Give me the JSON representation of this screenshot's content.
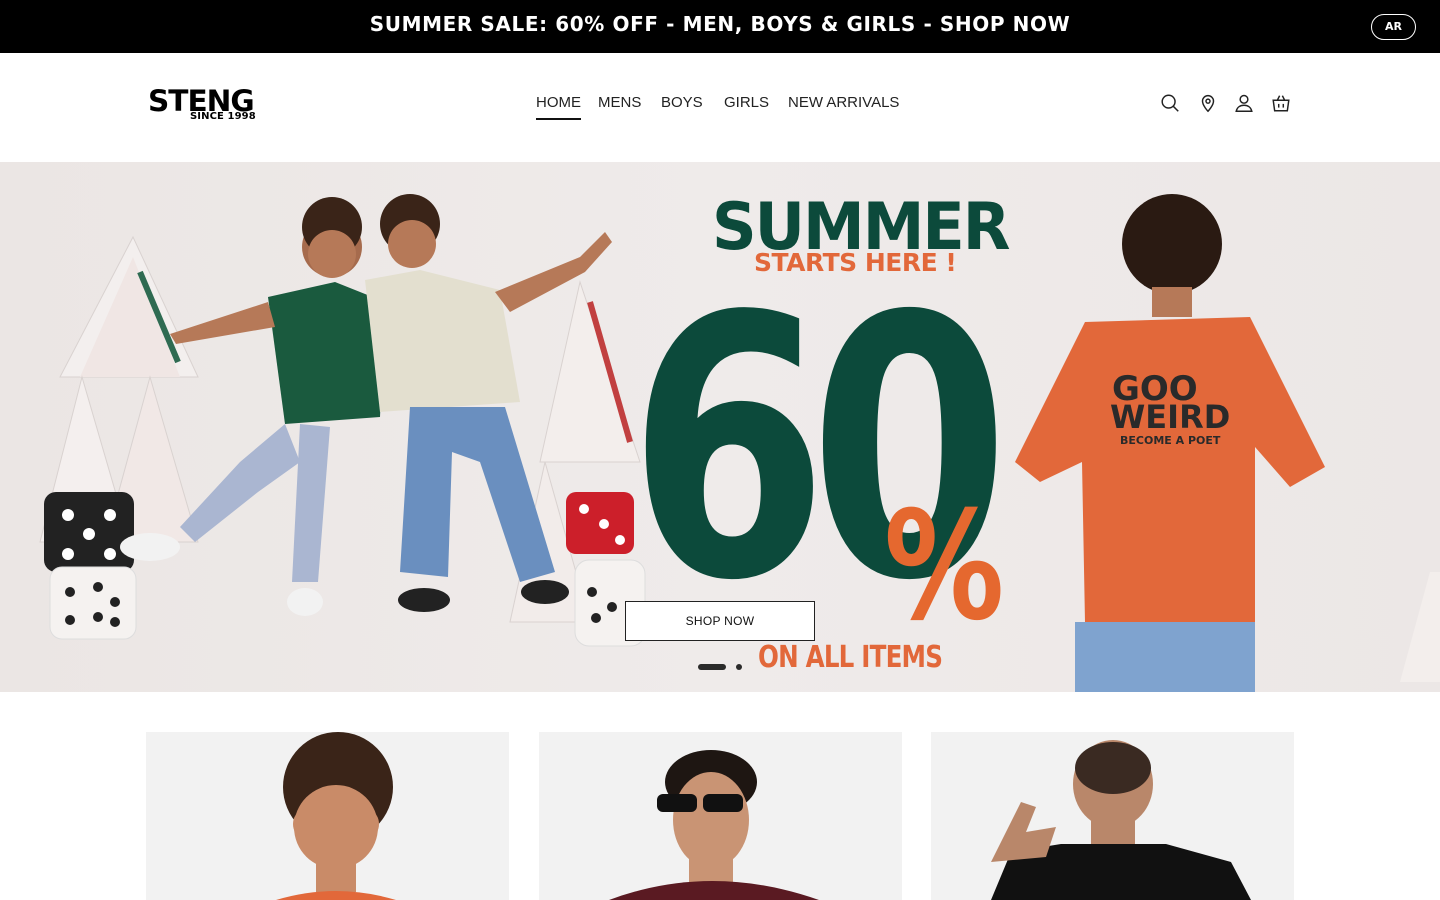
{
  "announcement": {
    "text": "SUMMER SALE: 60% OFF - MEN, BOYS & GIRLS - SHOP NOW",
    "language_button": "AR"
  },
  "header": {
    "logo": {
      "name": "STENG",
      "tagline": "SINCE 1998"
    },
    "nav": [
      {
        "label": "HOME",
        "active": true
      },
      {
        "label": "MENS",
        "active": false
      },
      {
        "label": "BOYS",
        "active": false
      },
      {
        "label": "GIRLS",
        "active": false
      },
      {
        "label": "NEW ARRIVALS",
        "active": false
      }
    ],
    "icons": [
      "search-icon",
      "location-pin-icon",
      "user-account-icon",
      "shopping-bag-icon"
    ]
  },
  "hero": {
    "headline": "SUMMER",
    "subheadline": "STARTS HERE !",
    "discount_number": "60",
    "discount_symbol": "%",
    "footer_text": "ON ALL ITEMS",
    "cta": "SHOP NOW",
    "shirt_print": {
      "line1": "GOO",
      "line2": "WEIRD",
      "line3": "BECOME A POET"
    },
    "slides": {
      "count": 2,
      "active": 1
    }
  },
  "colors": {
    "announcement_bg": "#000000",
    "hero_green": "#0c4a3b",
    "hero_orange": "#e2683a",
    "hero_bg": "#ece7e6",
    "tile_bg": "#f2f2f2"
  },
  "category_tiles": [
    {
      "image": "boy-with-curly-hair-orange-tshirt"
    },
    {
      "image": "man-with-sunglasses-maroon-polo"
    },
    {
      "image": "man-back-view-black-tshirt"
    }
  ]
}
